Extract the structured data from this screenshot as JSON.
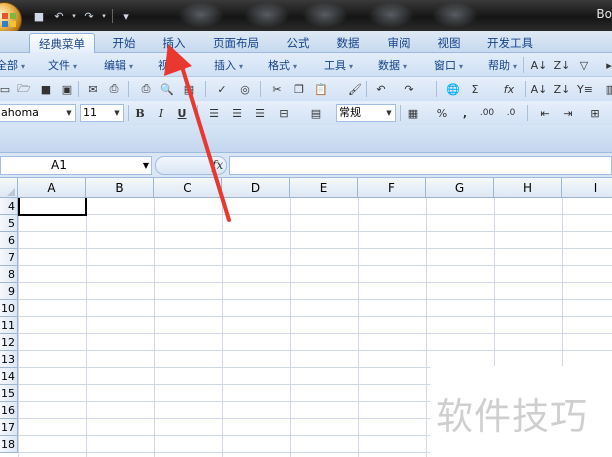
{
  "window": {
    "title_fragment": "Bo"
  },
  "quick_access": [
    {
      "icon": "save-icon",
      "glyph": "■"
    },
    {
      "icon": "undo-icon",
      "glyph": "↶"
    },
    {
      "icon": "redo-icon",
      "glyph": "↷"
    },
    {
      "icon": "customize-qat-icon",
      "glyph": "▾"
    }
  ],
  "ribbon_tabs": [
    {
      "label": "经典菜单",
      "active": true
    },
    {
      "label": "开始",
      "active": false
    },
    {
      "label": "插入",
      "active": false
    },
    {
      "label": "页面布局",
      "active": false
    },
    {
      "label": "公式",
      "active": false
    },
    {
      "label": "数据",
      "active": false
    },
    {
      "label": "审阅",
      "active": false
    },
    {
      "label": "视图",
      "active": false
    },
    {
      "label": "开发工具",
      "active": false
    }
  ],
  "classic_menu": [
    "全部",
    "文件",
    "编辑",
    "视图",
    "插入",
    "格式",
    "工具",
    "数据",
    "窗口",
    "帮助"
  ],
  "format_toolbar": {
    "font_name": "ahoma",
    "font_size": "11",
    "number_format": "常规",
    "bold": "B",
    "italic": "I",
    "underline": "U",
    "percent": "%",
    "comma": ",",
    "sigma": "Σ",
    "fx": "fx"
  },
  "formula_bar": {
    "name_box": "A1",
    "fx_label": "fx",
    "value": ""
  },
  "grid": {
    "columns": [
      "A",
      "B",
      "C",
      "D",
      "E",
      "F",
      "G",
      "H",
      "I"
    ],
    "rows": [
      "4",
      "5",
      "6",
      "7",
      "8",
      "9",
      "10",
      "11",
      "12",
      "13",
      "14",
      "15",
      "16",
      "17",
      "18"
    ]
  },
  "watermark": "软件技巧",
  "colors": {
    "ribbon": "#c6d9ef",
    "arrow": "#e8382f",
    "grid_line": "#d0d7e5"
  }
}
